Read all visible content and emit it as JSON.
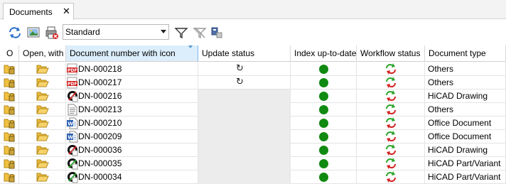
{
  "tab": {
    "title": "Documents",
    "close_glyph": "✕"
  },
  "toolbar": {
    "icons": [
      "sync-icon",
      "image-preview-icon",
      "print-delete-icon",
      "filter-icon",
      "clear-filter-icon",
      "copy-format-icon"
    ],
    "view_select": {
      "value": "Standard"
    }
  },
  "columns": {
    "c0": "O",
    "c1": "Open, with",
    "c2": "Document number with icon",
    "c3": "Update status",
    "c4": "Index up-to-date",
    "c5": "Workflow status",
    "c6": "Document type"
  },
  "sorted_column": "Document number with icon",
  "rows": [
    {
      "docnum": "DN-000218",
      "doc_icon": "pdf-icon",
      "update_status": "refresh",
      "index_ok": true,
      "workflow": "workflow-cycle",
      "doctype": "Others"
    },
    {
      "docnum": "DN-000217",
      "doc_icon": "pdf-icon",
      "update_status": "refresh",
      "index_ok": true,
      "workflow": "workflow-cycle",
      "doctype": "Others"
    },
    {
      "docnum": "DN-000216",
      "doc_icon": "hicad-drawing-icon",
      "update_status": "",
      "index_ok": true,
      "workflow": "workflow-cycle",
      "doctype": "HiCAD Drawing"
    },
    {
      "docnum": "DN-000213",
      "doc_icon": "text-file-icon",
      "update_status": "",
      "index_ok": true,
      "workflow": "workflow-cycle",
      "doctype": "Others"
    },
    {
      "docnum": "DN-000210",
      "doc_icon": "word-doc-icon",
      "update_status": "",
      "index_ok": true,
      "workflow": "workflow-cycle",
      "doctype": "Office Document"
    },
    {
      "docnum": "DN-000209",
      "doc_icon": "word-doc-icon",
      "update_status": "",
      "index_ok": true,
      "workflow": "workflow-cycle",
      "doctype": "Office Document"
    },
    {
      "docnum": "DN-000036",
      "doc_icon": "hicad-drawing-icon",
      "update_status": "",
      "index_ok": true,
      "workflow": "workflow-cycle",
      "doctype": "HiCAD Drawing"
    },
    {
      "docnum": "DN-000035",
      "doc_icon": "hicad-part-icon",
      "update_status": "",
      "index_ok": true,
      "workflow": "workflow-cycle",
      "doctype": "HiCAD Part/Variant"
    },
    {
      "docnum": "DN-000034",
      "doc_icon": "hicad-part-icon",
      "update_status": "",
      "index_ok": true,
      "workflow": "workflow-cycle",
      "doctype": "HiCAD Part/Variant"
    }
  ],
  "colors": {
    "index_ok": "#118a11",
    "sorted_header": "#dceefb",
    "folder": "#f0c040",
    "pdf": "#d42020"
  }
}
